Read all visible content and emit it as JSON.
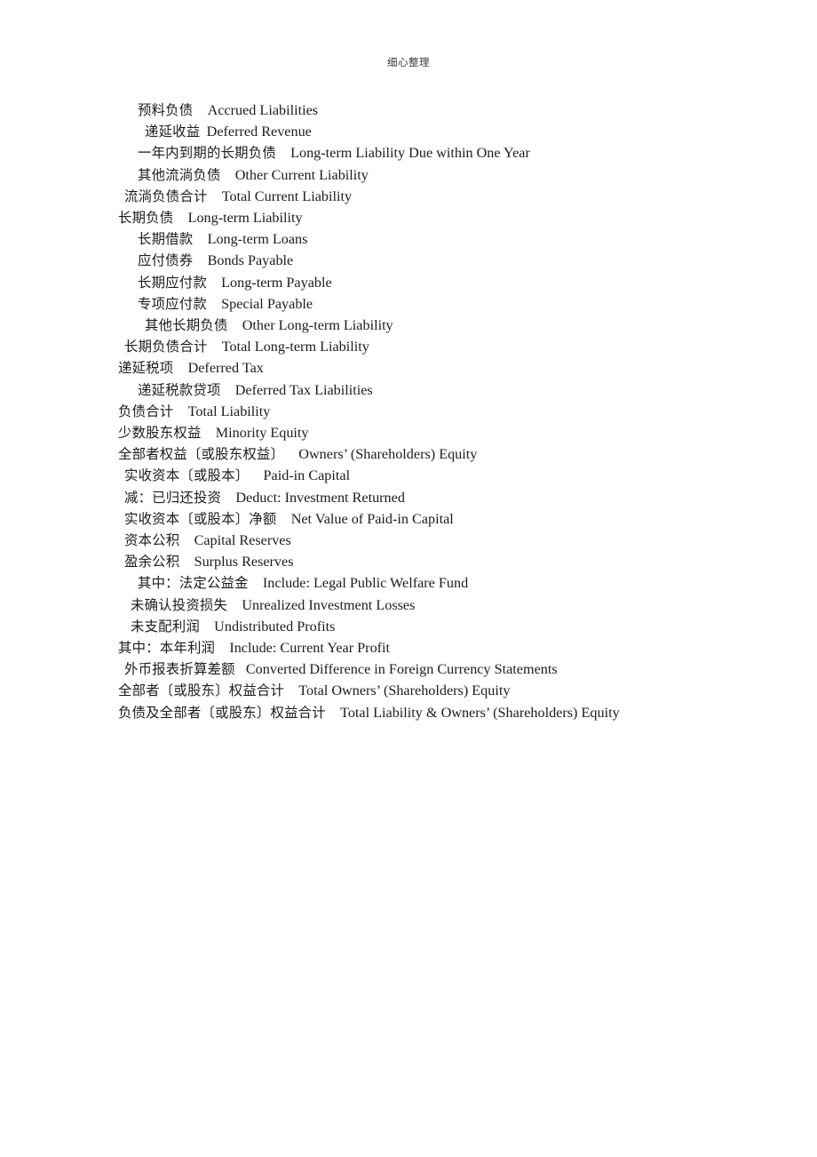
{
  "header": {
    "text": "细心整理"
  },
  "document": {
    "lines": [
      {
        "indent": "i3",
        "cn": "预料负债",
        "gapEm": 1.0,
        "en": "Accrued Liabilities"
      },
      {
        "indent": "i4",
        "cn": "递延收益",
        "gapEm": 0.45,
        "en": "Deferred Revenue"
      },
      {
        "indent": "i3",
        "cn": "一年内到期的长期负债",
        "gapEm": 1.0,
        "en": "Long-term Liability Due within One Year"
      },
      {
        "indent": "i3",
        "cn": "其他流淌负债",
        "gapEm": 1.0,
        "en": "Other Current Liability"
      },
      {
        "indent": "i1",
        "cn": "流淌负债合计",
        "gapEm": 1.0,
        "en": "Total Current Liability"
      },
      {
        "indent": "i0",
        "cn": "长期负债",
        "gapEm": 1.0,
        "en": "Long-term Liability"
      },
      {
        "indent": "i3",
        "cn": "长期借款",
        "gapEm": 1.0,
        "en": "Long-term Loans"
      },
      {
        "indent": "i3",
        "cn": "应付债券",
        "gapEm": 1.0,
        "en": "Bonds Payable"
      },
      {
        "indent": "i3",
        "cn": "长期应付款",
        "gapEm": 1.0,
        "en": "Long-term Payable"
      },
      {
        "indent": "i3",
        "cn": "专项应付款",
        "gapEm": 1.0,
        "en": "Special Payable"
      },
      {
        "indent": "i4",
        "cn": "其他长期负债",
        "gapEm": 1.0,
        "en": "Other Long-term Liability"
      },
      {
        "indent": "i1",
        "cn": "长期负债合计",
        "gapEm": 1.0,
        "en": "Total Long-term Liability"
      },
      {
        "indent": "i0",
        "cn": "递延税项",
        "gapEm": 1.0,
        "en": "Deferred Tax"
      },
      {
        "indent": "i3",
        "cn": "递延税款贷项",
        "gapEm": 1.0,
        "en": "Deferred Tax Liabilities"
      },
      {
        "indent": "i0",
        "cn": "负债合计",
        "gapEm": 1.0,
        "en": "Total Liability"
      },
      {
        "indent": "i0",
        "cn": "少数股东权益",
        "gapEm": 1.0,
        "en": "Minority Equity"
      },
      {
        "indent": "i0",
        "cn": "全部者权益〔或股东权益〕",
        "gapEm": 1.0,
        "en": "Owners’ (Shareholders) Equity"
      },
      {
        "indent": "i1",
        "cn": "实收资本〔或股本〕",
        "gapEm": 1.0,
        "en": "Paid-in Capital"
      },
      {
        "indent": "i1",
        "cn": "减：已归还投资",
        "gapEm": 1.0,
        "en": "Deduct: Investment Returned"
      },
      {
        "indent": "i1",
        "cn": "实收资本〔或股本〕净额",
        "gapEm": 1.0,
        "en": "Net Value of Paid-in Capital"
      },
      {
        "indent": "i1",
        "cn": "资本公积",
        "gapEm": 1.0,
        "en": "Capital Reserves"
      },
      {
        "indent": "i1",
        "cn": "盈余公积",
        "gapEm": 1.0,
        "en": "Surplus Reserves"
      },
      {
        "indent": "i3",
        "cn": "其中：法定公益金",
        "gapEm": 1.0,
        "en": "Include: Legal Public Welfare Fund"
      },
      {
        "indent": "i2",
        "cn": "未确认投资损失",
        "gapEm": 1.0,
        "en": "Unrealized Investment Losses"
      },
      {
        "indent": "i2",
        "cn": "未支配利润",
        "gapEm": 1.0,
        "en": "Undistributed Profits"
      },
      {
        "indent": "i0",
        "cn": "其中：本年利润",
        "gapEm": 1.0,
        "en": "Include: Current Year Profit"
      },
      {
        "indent": "i1",
        "cn": "外币报表折算差额",
        "gapEm": 0.75,
        "en": "Converted Difference in Foreign Currency Statements"
      },
      {
        "indent": "i0",
        "cn": "全部者〔或股东〕权益合计",
        "gapEm": 1.0,
        "en": "Total Owners’ (Shareholders) Equity"
      },
      {
        "indent": "i0",
        "cn": "负债及全部者〔或股东〕权益合计",
        "gapEm": 1.0,
        "en": "Total Liability & Owners’ (Shareholders) Equity"
      }
    ]
  }
}
